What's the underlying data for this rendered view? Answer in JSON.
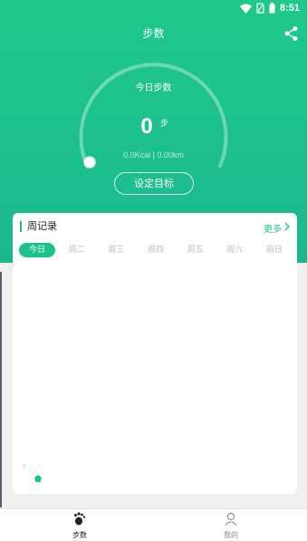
{
  "status": {
    "time": "8:51"
  },
  "header": {
    "title": "步数"
  },
  "gauge": {
    "today_label": "今日步数",
    "steps": "0",
    "unit": "步",
    "stats": "0.0Kcal | 0.00km",
    "goal_button": "设定目标",
    "progress": 0
  },
  "week": {
    "title": "周记录",
    "more": "更多",
    "days": [
      "今日",
      "周二",
      "周三",
      "周四",
      "周五",
      "周六",
      "周日"
    ],
    "active_index": 0,
    "bar_value": "0"
  },
  "nav": {
    "steps": "步数",
    "me": "我的"
  },
  "colors": {
    "accent": "#1dc288",
    "header": "#1fc98a"
  }
}
